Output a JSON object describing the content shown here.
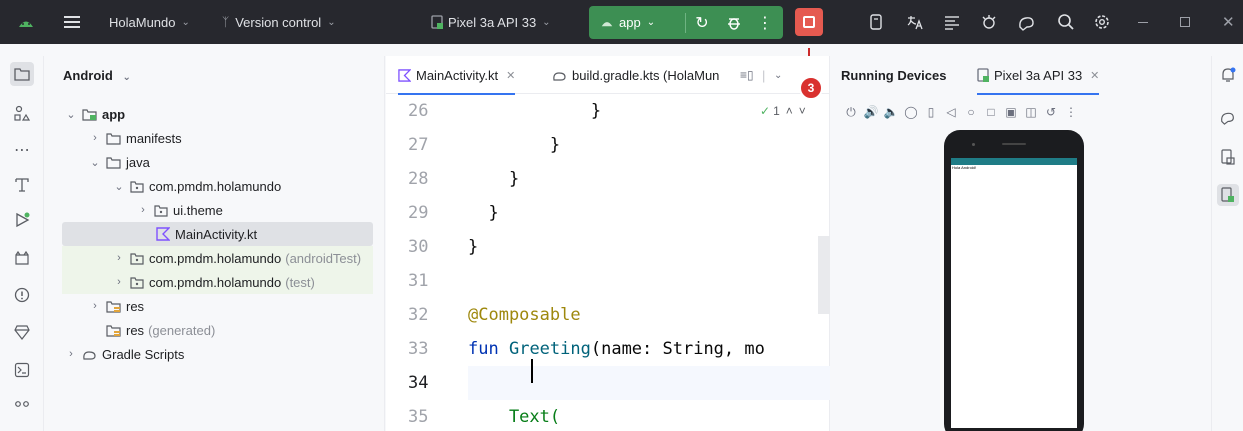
{
  "titlebar": {
    "project_name": "HolaMundo",
    "vcs_label": "Version control",
    "device": "Pixel 3a API 33",
    "run_config": "app",
    "badge": "3"
  },
  "project_panel": {
    "view_mode": "Android",
    "tree": [
      {
        "label": "app",
        "bold": true
      },
      {
        "label": "manifests"
      },
      {
        "label": "java"
      },
      {
        "label": "com.pmdm.holamundo"
      },
      {
        "label": "ui.theme"
      },
      {
        "label": "MainActivity.kt"
      },
      {
        "label": "com.pmdm.holamundo",
        "suffix": "(androidTest)"
      },
      {
        "label": "com.pmdm.holamundo",
        "suffix": "(test)"
      },
      {
        "label": "res"
      },
      {
        "label": "res",
        "suffix": "(generated)"
      },
      {
        "label": "Gradle Scripts"
      }
    ]
  },
  "editor": {
    "tabs": [
      {
        "label": "MainActivity.kt"
      },
      {
        "label": "build.gradle.kts (HolaMun"
      }
    ],
    "lint_count": "1",
    "line_numbers": [
      "26",
      "27",
      "28",
      "29",
      "30",
      "31",
      "32",
      "33",
      "34",
      "35"
    ],
    "lines": [
      "            }",
      "        }",
      "    }",
      "  }",
      "}",
      "",
      "@Composable",
      "fun Greeting(name: String, mo",
      "    ",
      "    Text("
    ]
  },
  "devices": {
    "title": "Running Devices",
    "device_tab": "Pixel 3a API 33",
    "screen_text": "Hola Android!"
  },
  "colors": {
    "run_green": "#3d8f53",
    "stop_red": "#e55a50",
    "badge_red": "#d9312f",
    "accent_blue": "#3574f0"
  }
}
